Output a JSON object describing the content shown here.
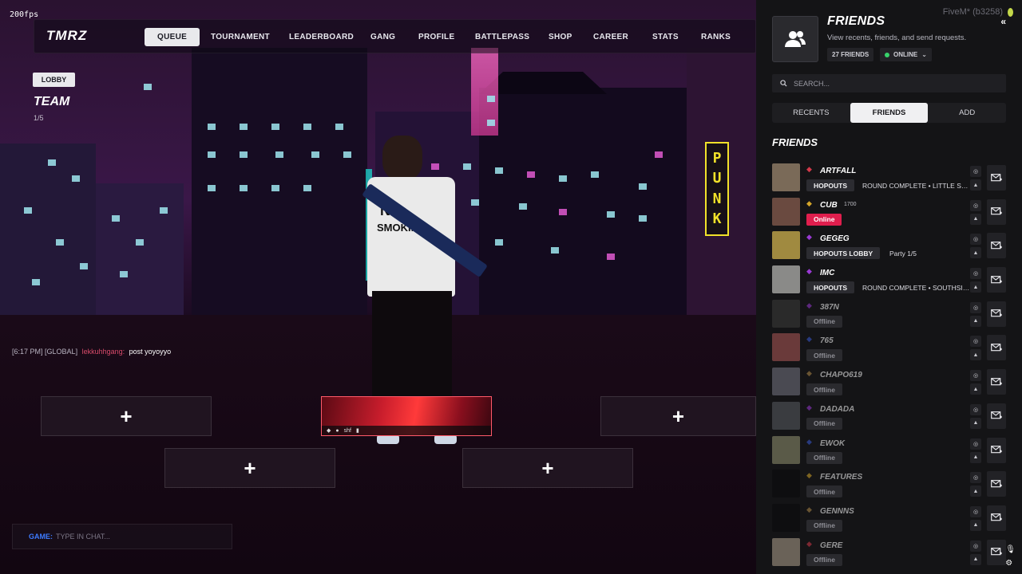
{
  "fps": "200fps",
  "nav": {
    "logo": "TMRZ",
    "items": [
      "QUEUE",
      "TOURNAMENT",
      "LEADERBOARD",
      "GANG",
      "PROFILE",
      "BATTLEPASS",
      "SHOP",
      "CAREER",
      "STATS",
      "RANKS"
    ],
    "active_index": 0
  },
  "lobby": {
    "badge": "LOBBY",
    "team_title": "TEAM",
    "team_count": "1/5"
  },
  "scene": {
    "sign_text": "PUNK",
    "shirt_line1": "NO",
    "shirt_line2": "SMOKING"
  },
  "chat": {
    "time": "[6:17 PM]",
    "channel": "[GLOBAL]",
    "user": "lekkuhhgang:",
    "message": "post yoyoyyo",
    "input_prefix": "GAME:",
    "input_placeholder": "TYPE IN CHAT..."
  },
  "slots": {
    "plus": "+",
    "player_card_name": "shf"
  },
  "panel": {
    "client_label": "FiveM* (b3258)",
    "title": "FRIENDS",
    "subtitle": "View recents, friends, and send requests.",
    "friend_count": "27 FRIENDS",
    "status": "ONLINE",
    "search_placeholder": "SEARCH...",
    "tabs": [
      "RECENTS",
      "FRIENDS",
      "ADD"
    ],
    "active_tab": 1,
    "section_title": "FRIENDS"
  },
  "friends": [
    {
      "name": "ARTFALL",
      "extra": "",
      "rank_color": "#d43a4a",
      "status": "HOPOUTS",
      "status_type": "activity",
      "detail": "ROUND COMPLETE • LITTLE SEOUL",
      "avatar": "#7a6a58"
    },
    {
      "name": "CUB",
      "extra": "1700",
      "rank_color": "#d4a62a",
      "status": "Online",
      "status_type": "online",
      "detail": "",
      "avatar": "#6a4a40"
    },
    {
      "name": "GEGEG",
      "extra": "",
      "rank_color": "#9a3ad4",
      "status": "HOPOUTS LOBBY",
      "status_type": "activity",
      "detail": "Party 1/5",
      "avatar": "#a08a40"
    },
    {
      "name": "IMC",
      "extra": "",
      "rank_color": "#9a3ad4",
      "status": "HOPOUTS",
      "status_type": "activity",
      "detail": "ROUND COMPLETE • SOUTHSIDE",
      "avatar": "#8a8a88"
    },
    {
      "name": "387N",
      "extra": "",
      "rank_color": "#9a3ad4",
      "status": "Offline",
      "status_type": "offline",
      "detail": "",
      "avatar": "#2a2a2a"
    },
    {
      "name": "765",
      "extra": "",
      "rank_color": "#3a5ad4",
      "status": "Offline",
      "status_type": "offline",
      "detail": "",
      "avatar": "#6a3a3a"
    },
    {
      "name": "CHAPO619",
      "extra": "",
      "rank_color": "#b08a4a",
      "status": "Offline",
      "status_type": "offline",
      "detail": "",
      "avatar": "#4a4a52"
    },
    {
      "name": "DADADA",
      "extra": "",
      "rank_color": "#9a3ad4",
      "status": "Offline",
      "status_type": "offline",
      "detail": "",
      "avatar": "#3a3c40"
    },
    {
      "name": "EWOK",
      "extra": "",
      "rank_color": "#3a5ad4",
      "status": "Offline",
      "status_type": "offline",
      "detail": "",
      "avatar": "#5a5a48"
    },
    {
      "name": "FEATURES",
      "extra": "",
      "rank_color": "#d4a62a",
      "status": "Offline",
      "status_type": "offline",
      "detail": "",
      "avatar": "#0e0e10"
    },
    {
      "name": "GENNNS",
      "extra": "",
      "rank_color": "#b08a4a",
      "status": "Offline",
      "status_type": "offline",
      "detail": "",
      "avatar": "#0e0e10"
    },
    {
      "name": "GERE",
      "extra": "",
      "rank_color": "#d43a4a",
      "status": "Offline",
      "status_type": "offline",
      "detail": "",
      "avatar": "#6a6258"
    }
  ]
}
